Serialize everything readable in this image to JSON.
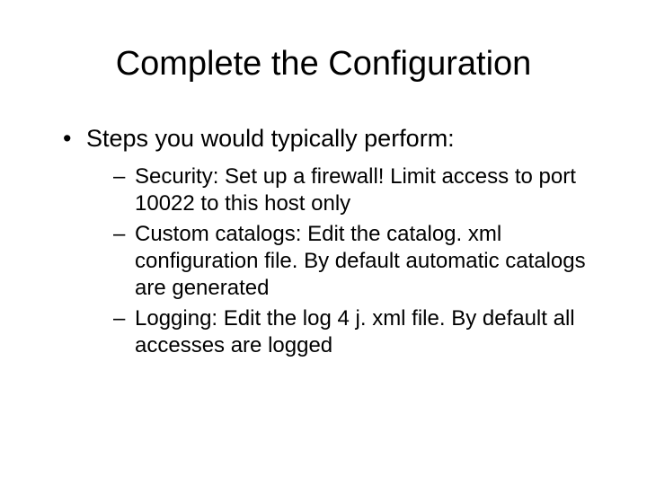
{
  "title": "Complete the Configuration",
  "bullets": [
    {
      "text": "Steps you would typically perform:",
      "subs": [
        "Security: Set up a firewall! Limit access to port 10022 to this host only",
        "Custom catalogs: Edit the catalog. xml configuration file. By default automatic catalogs are generated",
        "Logging: Edit the log 4 j. xml file. By default all accesses are logged"
      ]
    }
  ]
}
